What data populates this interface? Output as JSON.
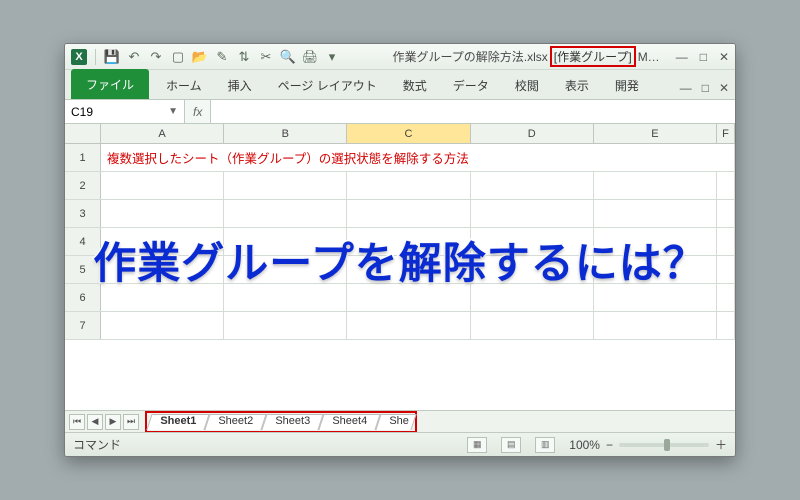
{
  "title": {
    "filename": "作業グループの解除方法.xlsx",
    "group_tag": "[作業グループ]",
    "app_suffix": "M…"
  },
  "ribbon": {
    "file": "ファイル",
    "tabs": [
      "ホーム",
      "挿入",
      "ページ レイアウト",
      "数式",
      "データ",
      "校閲",
      "表示",
      "開発"
    ]
  },
  "namebox": "C19",
  "fx_label": "fx",
  "columns": [
    "A",
    "B",
    "C",
    "D",
    "E",
    "F"
  ],
  "selected_col_index": 2,
  "row_numbers": [
    "1",
    "2",
    "3",
    "4",
    "5",
    "6",
    "7"
  ],
  "row1_text": "複数選択したシート（作業グループ）の選択状態を解除する方法",
  "sheet_tabs": [
    "Sheet1",
    "Sheet2",
    "Sheet3",
    "Sheet4",
    "She"
  ],
  "status": {
    "mode": "コマンド",
    "zoom": "100%",
    "minus": "−",
    "plus": "＋"
  },
  "overlay_headline": "作業グループを解除するには？",
  "winbtns": {
    "min": "—",
    "max": "□",
    "close": "✕"
  },
  "qat_icons": {
    "save": "💾",
    "undo": "↶",
    "redo": "↷",
    "new": "▢",
    "open": "📂",
    "brush": "✎",
    "sort": "⇅",
    "cut": "✂",
    "preview": "🔍",
    "print": "🖨",
    "more": "▾"
  },
  "nav": {
    "first": "⏮",
    "prev": "◀",
    "next": "▶",
    "last": "⏭"
  },
  "views": {
    "normal": "▦",
    "layout": "▤",
    "break": "▥"
  }
}
